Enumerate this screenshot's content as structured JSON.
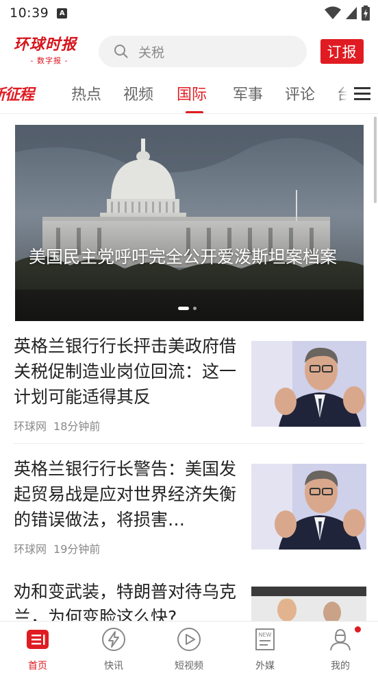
{
  "status_bar": {
    "time": "10:39",
    "a_icon_label": "A"
  },
  "header": {
    "logo_main": "环球时报",
    "logo_sub": "- 数字报 -",
    "search_placeholder": "关税",
    "subscribe_label": "订报"
  },
  "tabs": [
    {
      "label": "新征程",
      "active": false
    },
    {
      "label": "热点",
      "active": false
    },
    {
      "label": "视频",
      "active": false
    },
    {
      "label": "国际",
      "active": true
    },
    {
      "label": "军事",
      "active": false
    },
    {
      "label": "评论",
      "active": false
    },
    {
      "label": "台",
      "active": false
    }
  ],
  "hero": {
    "title": "美国民主党呼吁完全公开爱泼斯坦案档案",
    "slide_count": 2,
    "current_slide": 1
  },
  "news": [
    {
      "title": "英格兰银行行长抨击美政府借关税促制造业岗位回流：这一计划可能适得其反",
      "source": "环球网",
      "time": "18分钟前"
    },
    {
      "title": "英格兰银行行长警告：美国发起贸易战是应对世界经济失衡的错误做法，将损害…",
      "source": "环球网",
      "time": "19分钟前"
    },
    {
      "title": "劝和变武装，特朗普对待乌克兰，为何变脸这么快?",
      "source": "",
      "time": ""
    }
  ],
  "bottom_nav": [
    {
      "label": "首页",
      "icon": "home-icon",
      "active": true
    },
    {
      "label": "快讯",
      "icon": "lightning-icon",
      "active": false
    },
    {
      "label": "短视频",
      "icon": "play-icon",
      "active": false
    },
    {
      "label": "外媒",
      "icon": "news-icon",
      "active": false
    },
    {
      "label": "我的",
      "icon": "profile-icon",
      "active": false,
      "badge": true
    }
  ],
  "colors": {
    "brand_red": "#e01b22",
    "text_dark": "#222222",
    "text_muted": "#888888"
  }
}
